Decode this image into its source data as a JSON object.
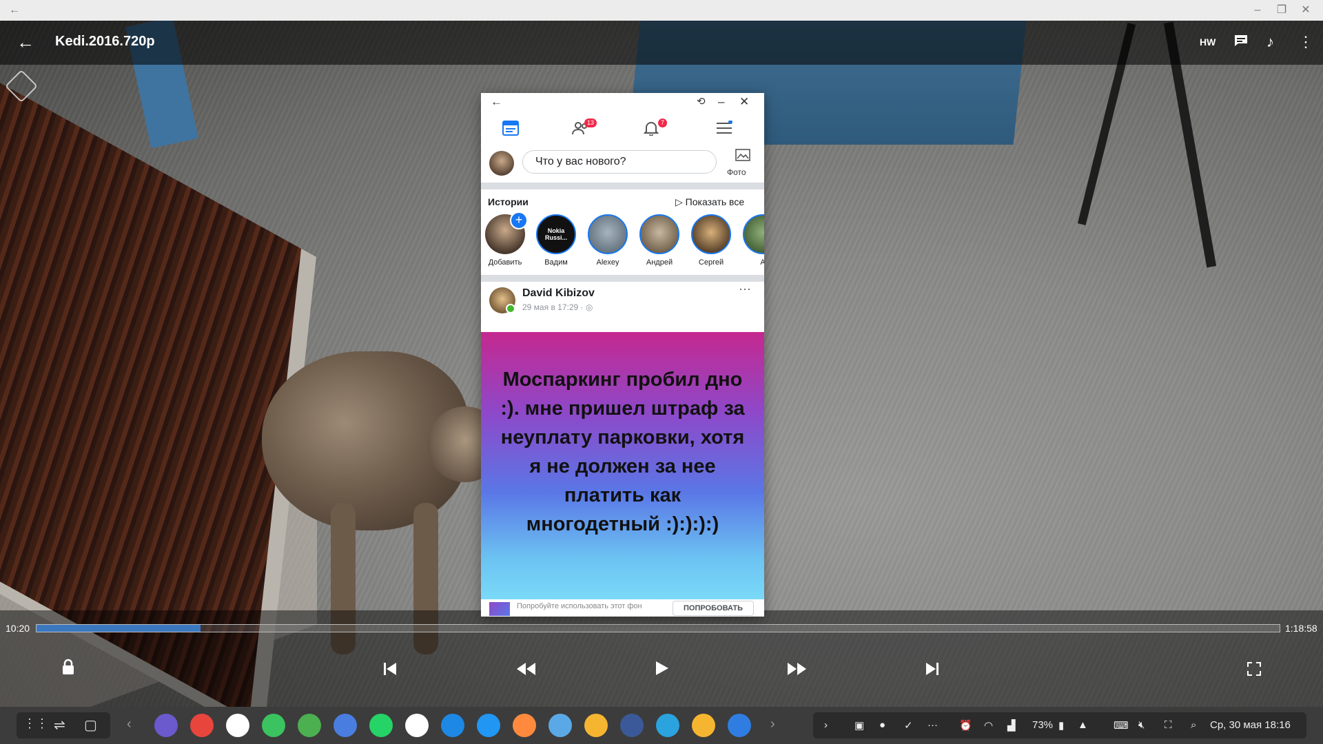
{
  "window": {
    "back_glyph": "←",
    "min_glyph": "–",
    "restore_glyph": "❐",
    "close_glyph": "✕"
  },
  "player": {
    "title": "Kedi.2016.720p",
    "hw_label": "HW",
    "time_elapsed": "10:20",
    "time_total": "1:18:58",
    "progress": 0.132
  },
  "facebook": {
    "compose_placeholder": "Что у вас нового?",
    "photo_label": "Фото",
    "badges": {
      "friends": "13",
      "notifications": "7"
    },
    "stories_title": "Истории",
    "show_all": "Показать все",
    "stories": [
      {
        "name": "Добавить",
        "inner": ""
      },
      {
        "name": "Вадим",
        "inner": "Nokia Russi..."
      },
      {
        "name": "Alexey",
        "inner": ""
      },
      {
        "name": "Андрей",
        "inner": ""
      },
      {
        "name": "Сергей",
        "inner": ""
      },
      {
        "name": "А",
        "inner": ""
      }
    ],
    "post": {
      "author": "David Kibizov",
      "time": "29 мая в 17:29 · ",
      "text": "Моспаркинг пробил дно :). мне пришел штраф за неуплату парковки, хотя я не должен за нее платить как многодетный :):):):)"
    },
    "try_text": "Попробуйте использовать этот фон",
    "try_button": "ПОПРОБОВАТЬ"
  },
  "taskbar": {
    "battery": "73%",
    "datetime": "Ср, 30 мая  18:16",
    "apps": [
      {
        "name": "samsung-internet-icon",
        "color": "#6a5acd"
      },
      {
        "name": "chrome-icon",
        "color": "#e8453c"
      },
      {
        "name": "play-store-icon",
        "color": "#ffffff"
      },
      {
        "name": "phone-icon",
        "color": "#3ac35f"
      },
      {
        "name": "maps-icon",
        "color": "#4caf50"
      },
      {
        "name": "calendar-icon",
        "color": "#4a7de0"
      },
      {
        "name": "whatsapp-icon",
        "color": "#25d366"
      },
      {
        "name": "gmail-icon",
        "color": "#ffffff"
      },
      {
        "name": "messenger-icon",
        "color": "#1e88e5"
      },
      {
        "name": "calculator-icon",
        "color": "#2196f3"
      },
      {
        "name": "bixby-icon",
        "color": "#ff8a3d"
      },
      {
        "name": "weather-icon",
        "color": "#5aa9e6"
      },
      {
        "name": "my-files-icon",
        "color": "#f6b530"
      },
      {
        "name": "facebook-icon",
        "color": "#3b5998"
      },
      {
        "name": "telegram-icon",
        "color": "#2aa3df"
      },
      {
        "name": "files-icon",
        "color": "#f6b530"
      },
      {
        "name": "video-player-icon",
        "color": "#2f7de1"
      }
    ]
  },
  "colors": {
    "accent": "#1877f2",
    "progress": "#3b78c0"
  }
}
